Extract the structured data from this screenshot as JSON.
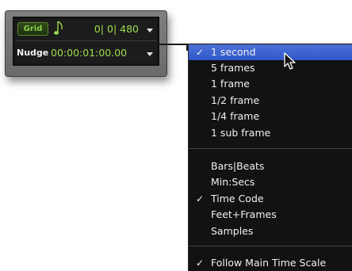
{
  "grid_nudge_panel": {
    "grid_button_label": "Grid",
    "grid_value": "0| 0| 480",
    "nudge_label": "Nudge",
    "nudge_value": "00:00:01:00.00",
    "note_icon": "eighth-note-icon",
    "dropdown_icon": "triangle-down-icon"
  },
  "nudge_menu": {
    "items": [
      {
        "label": "1 second",
        "checked": true,
        "highlighted": true
      },
      {
        "label": "5 frames",
        "checked": false
      },
      {
        "label": "1 frame",
        "checked": false
      },
      {
        "label": "1/2 frame",
        "checked": false
      },
      {
        "label": "1/4 frame",
        "checked": false
      },
      {
        "label": "1 sub frame",
        "checked": false
      },
      {
        "label": "Bars|Beats",
        "checked": false
      },
      {
        "label": "Min:Secs",
        "checked": false
      },
      {
        "label": "Time Code",
        "checked": true
      },
      {
        "label": "Feet+Frames",
        "checked": false
      },
      {
        "label": "Samples",
        "checked": false
      },
      {
        "label": "Follow Main Time Scale",
        "checked": true
      }
    ],
    "check_glyph": "✓"
  },
  "colors": {
    "counter_green": "#9bdc4f",
    "menu_background": "#121212",
    "menu_highlight": "#3a62cf"
  }
}
